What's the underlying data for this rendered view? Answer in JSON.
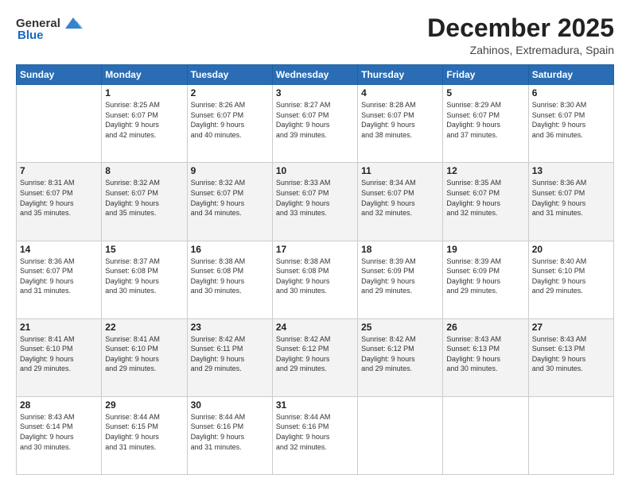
{
  "header": {
    "logo_general": "General",
    "logo_blue": "Blue",
    "month": "December 2025",
    "location": "Zahinos, Extremadura, Spain"
  },
  "weekdays": [
    "Sunday",
    "Monday",
    "Tuesday",
    "Wednesday",
    "Thursday",
    "Friday",
    "Saturday"
  ],
  "weeks": [
    [
      {
        "day": "",
        "info": ""
      },
      {
        "day": "1",
        "info": "Sunrise: 8:25 AM\nSunset: 6:07 PM\nDaylight: 9 hours\nand 42 minutes."
      },
      {
        "day": "2",
        "info": "Sunrise: 8:26 AM\nSunset: 6:07 PM\nDaylight: 9 hours\nand 40 minutes."
      },
      {
        "day": "3",
        "info": "Sunrise: 8:27 AM\nSunset: 6:07 PM\nDaylight: 9 hours\nand 39 minutes."
      },
      {
        "day": "4",
        "info": "Sunrise: 8:28 AM\nSunset: 6:07 PM\nDaylight: 9 hours\nand 38 minutes."
      },
      {
        "day": "5",
        "info": "Sunrise: 8:29 AM\nSunset: 6:07 PM\nDaylight: 9 hours\nand 37 minutes."
      },
      {
        "day": "6",
        "info": "Sunrise: 8:30 AM\nSunset: 6:07 PM\nDaylight: 9 hours\nand 36 minutes."
      }
    ],
    [
      {
        "day": "7",
        "info": "Sunrise: 8:31 AM\nSunset: 6:07 PM\nDaylight: 9 hours\nand 35 minutes."
      },
      {
        "day": "8",
        "info": "Sunrise: 8:32 AM\nSunset: 6:07 PM\nDaylight: 9 hours\nand 35 minutes."
      },
      {
        "day": "9",
        "info": "Sunrise: 8:32 AM\nSunset: 6:07 PM\nDaylight: 9 hours\nand 34 minutes."
      },
      {
        "day": "10",
        "info": "Sunrise: 8:33 AM\nSunset: 6:07 PM\nDaylight: 9 hours\nand 33 minutes."
      },
      {
        "day": "11",
        "info": "Sunrise: 8:34 AM\nSunset: 6:07 PM\nDaylight: 9 hours\nand 32 minutes."
      },
      {
        "day": "12",
        "info": "Sunrise: 8:35 AM\nSunset: 6:07 PM\nDaylight: 9 hours\nand 32 minutes."
      },
      {
        "day": "13",
        "info": "Sunrise: 8:36 AM\nSunset: 6:07 PM\nDaylight: 9 hours\nand 31 minutes."
      }
    ],
    [
      {
        "day": "14",
        "info": "Sunrise: 8:36 AM\nSunset: 6:07 PM\nDaylight: 9 hours\nand 31 minutes."
      },
      {
        "day": "15",
        "info": "Sunrise: 8:37 AM\nSunset: 6:08 PM\nDaylight: 9 hours\nand 30 minutes."
      },
      {
        "day": "16",
        "info": "Sunrise: 8:38 AM\nSunset: 6:08 PM\nDaylight: 9 hours\nand 30 minutes."
      },
      {
        "day": "17",
        "info": "Sunrise: 8:38 AM\nSunset: 6:08 PM\nDaylight: 9 hours\nand 30 minutes."
      },
      {
        "day": "18",
        "info": "Sunrise: 8:39 AM\nSunset: 6:09 PM\nDaylight: 9 hours\nand 29 minutes."
      },
      {
        "day": "19",
        "info": "Sunrise: 8:39 AM\nSunset: 6:09 PM\nDaylight: 9 hours\nand 29 minutes."
      },
      {
        "day": "20",
        "info": "Sunrise: 8:40 AM\nSunset: 6:10 PM\nDaylight: 9 hours\nand 29 minutes."
      }
    ],
    [
      {
        "day": "21",
        "info": "Sunrise: 8:41 AM\nSunset: 6:10 PM\nDaylight: 9 hours\nand 29 minutes."
      },
      {
        "day": "22",
        "info": "Sunrise: 8:41 AM\nSunset: 6:10 PM\nDaylight: 9 hours\nand 29 minutes."
      },
      {
        "day": "23",
        "info": "Sunrise: 8:42 AM\nSunset: 6:11 PM\nDaylight: 9 hours\nand 29 minutes."
      },
      {
        "day": "24",
        "info": "Sunrise: 8:42 AM\nSunset: 6:12 PM\nDaylight: 9 hours\nand 29 minutes."
      },
      {
        "day": "25",
        "info": "Sunrise: 8:42 AM\nSunset: 6:12 PM\nDaylight: 9 hours\nand 29 minutes."
      },
      {
        "day": "26",
        "info": "Sunrise: 8:43 AM\nSunset: 6:13 PM\nDaylight: 9 hours\nand 30 minutes."
      },
      {
        "day": "27",
        "info": "Sunrise: 8:43 AM\nSunset: 6:13 PM\nDaylight: 9 hours\nand 30 minutes."
      }
    ],
    [
      {
        "day": "28",
        "info": "Sunrise: 8:43 AM\nSunset: 6:14 PM\nDaylight: 9 hours\nand 30 minutes."
      },
      {
        "day": "29",
        "info": "Sunrise: 8:44 AM\nSunset: 6:15 PM\nDaylight: 9 hours\nand 31 minutes."
      },
      {
        "day": "30",
        "info": "Sunrise: 8:44 AM\nSunset: 6:16 PM\nDaylight: 9 hours\nand 31 minutes."
      },
      {
        "day": "31",
        "info": "Sunrise: 8:44 AM\nSunset: 6:16 PM\nDaylight: 9 hours\nand 32 minutes."
      },
      {
        "day": "",
        "info": ""
      },
      {
        "day": "",
        "info": ""
      },
      {
        "day": "",
        "info": ""
      }
    ]
  ]
}
